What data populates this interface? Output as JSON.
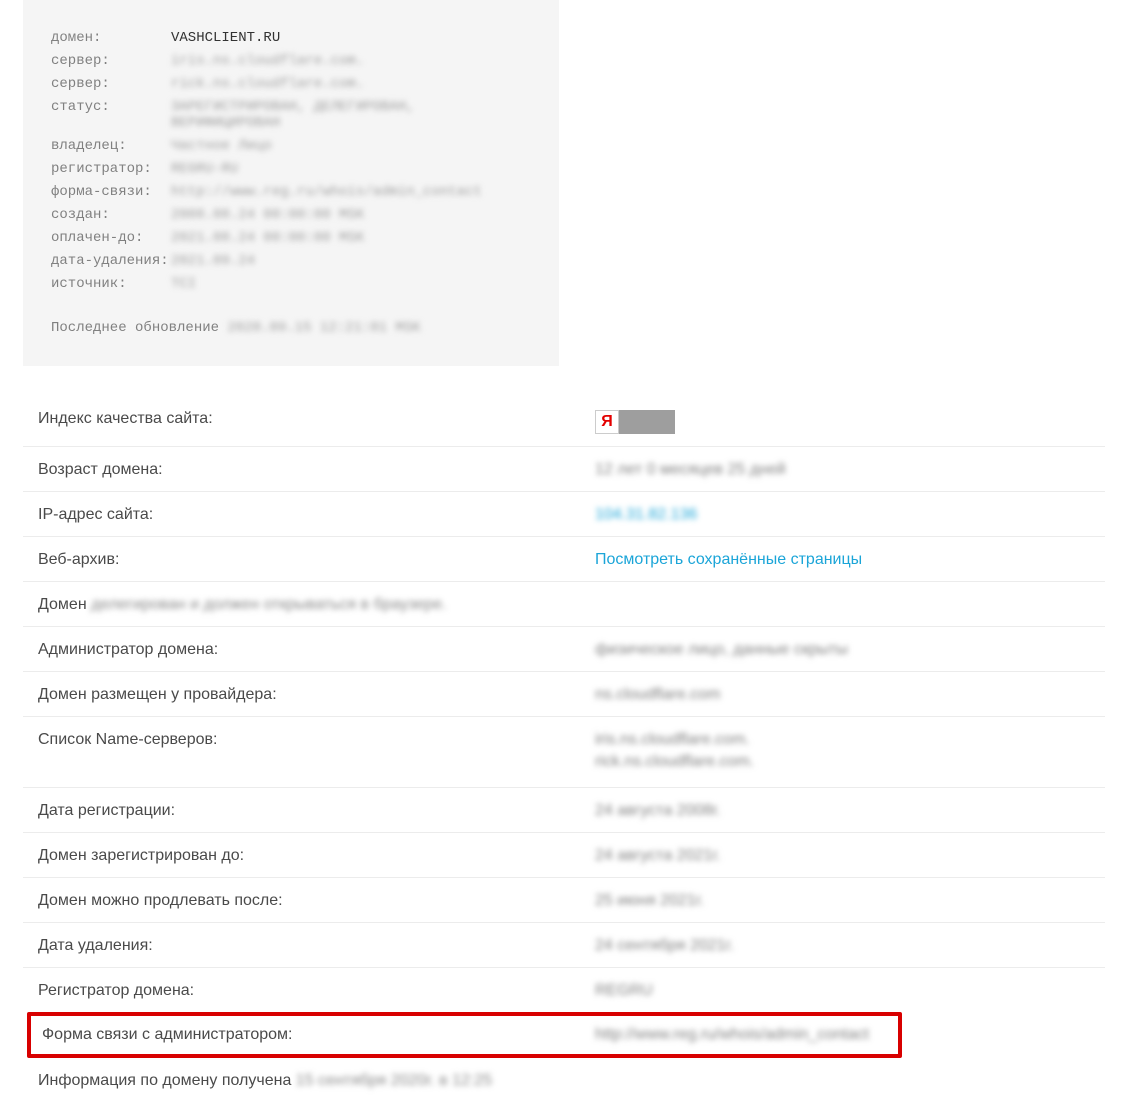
{
  "whois": {
    "labels": {
      "domain": "домен:",
      "server1": "сервер:",
      "server2": "сервер:",
      "status": "статус:",
      "owner": "владелец:",
      "registrar": "регистратор:",
      "contact_form": "форма-связи:",
      "created": "создан:",
      "paid_till": "оплачен-до:",
      "delete_date": "дата-удаления:",
      "source": "источник:"
    },
    "values": {
      "domain": "VASHCLIENT.RU",
      "server1": "iris.ns.cloudflare.com.",
      "server2": "rick.ns.cloudflare.com.",
      "status": "ЗАРЕГИСТРИРОВАН, ДЕЛЕГИРОВАН, ВЕРИФИЦИРОВАН",
      "owner": "Частное Лицо",
      "registrar": "REGRU-RU",
      "contact_form": "http://www.reg.ru/whois/admin_contact",
      "created": "2008.08.24 00:00:00 MSK",
      "paid_till": "2021.08.24 00:00:00 MSK",
      "delete_date": "2021.09.24",
      "source": "TCI"
    },
    "footer_label": "Последнее обновление",
    "footer_value": "2020.09.15 12:21:01 MSK"
  },
  "info": {
    "quality_label": "Индекс качества сайта:",
    "age_label": "Возраст домена:",
    "age_value": "12 лет 0 месяцев 25 дней",
    "ip_label": "IP-адрес сайта:",
    "ip_value": "104.31.82.136",
    "archive_label": "Веб-архив:",
    "archive_value": "Посмотреть сохранённые страницы",
    "domain_prefix": "Домен",
    "domain_suffix": "делегирован и должен открываться в браузере.",
    "admin_label": "Администратор домена:",
    "admin_value": "физическое лицо, данные скрыты",
    "provider_label": "Домен размещен у провайдера:",
    "provider_value": "ns.cloudflare.com",
    "ns_label": "Список Name-серверов:",
    "ns_value1": "iris.ns.cloudflare.com.",
    "ns_value2": "rick.ns.cloudflare.com.",
    "reg_date_label": "Дата регистрации:",
    "reg_date_value": "24 августа 2008г.",
    "reg_until_label": "Домен зарегистрирован до:",
    "reg_until_value": "24 августа 2021г.",
    "renew_after_label": "Домен можно продлевать после:",
    "renew_after_value": "25 июня 2021г.",
    "delete_label": "Дата удаления:",
    "delete_value": "24 сентября 2021г.",
    "registrar_label": "Регистратор домена:",
    "registrar_value": "REGRU",
    "contact_label": "Форма связи с администратором:",
    "contact_value": "http://www.reg.ru/whois/admin_contact",
    "obtained_prefix": "Информация по домену получена",
    "obtained_suffix": "15 сентября 2020г. в 12:25"
  },
  "ya_logo": "Я"
}
